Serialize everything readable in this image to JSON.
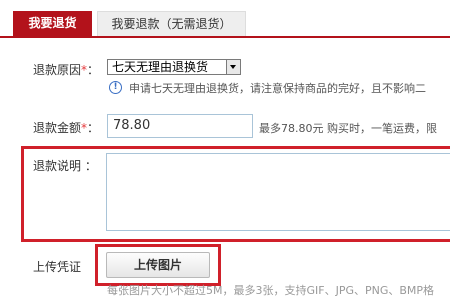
{
  "tabs": {
    "active_label": "我要退货",
    "inactive_label": "我要退款（无需退货）"
  },
  "form": {
    "reason": {
      "label": "退款原因",
      "required_mark": "*",
      "colon": "：",
      "selected": "七天无理由退换货",
      "info_text": "申请七天无理由退换货，请注意保持商品的完好，且不影响二"
    },
    "amount": {
      "label": "退款金额",
      "required_mark": "*",
      "colon": "：",
      "value": "78.80",
      "hint": "最多78.80元 购买时，一笔运费，限"
    },
    "description": {
      "label": "退款说明 ：",
      "value": ""
    },
    "upload": {
      "label": "上传凭证",
      "button_label": "上传图片",
      "note": "每张图片大小不超过5M，最多3张，支持GIF、JPG、PNG、BMP格"
    }
  },
  "colors": {
    "accent": "#b3121b",
    "highlight_border": "#d0202a",
    "info_icon": "#3a6fc4"
  },
  "icons": {
    "info": "info-circle-icon",
    "dropdown": "chevron-down-icon"
  }
}
